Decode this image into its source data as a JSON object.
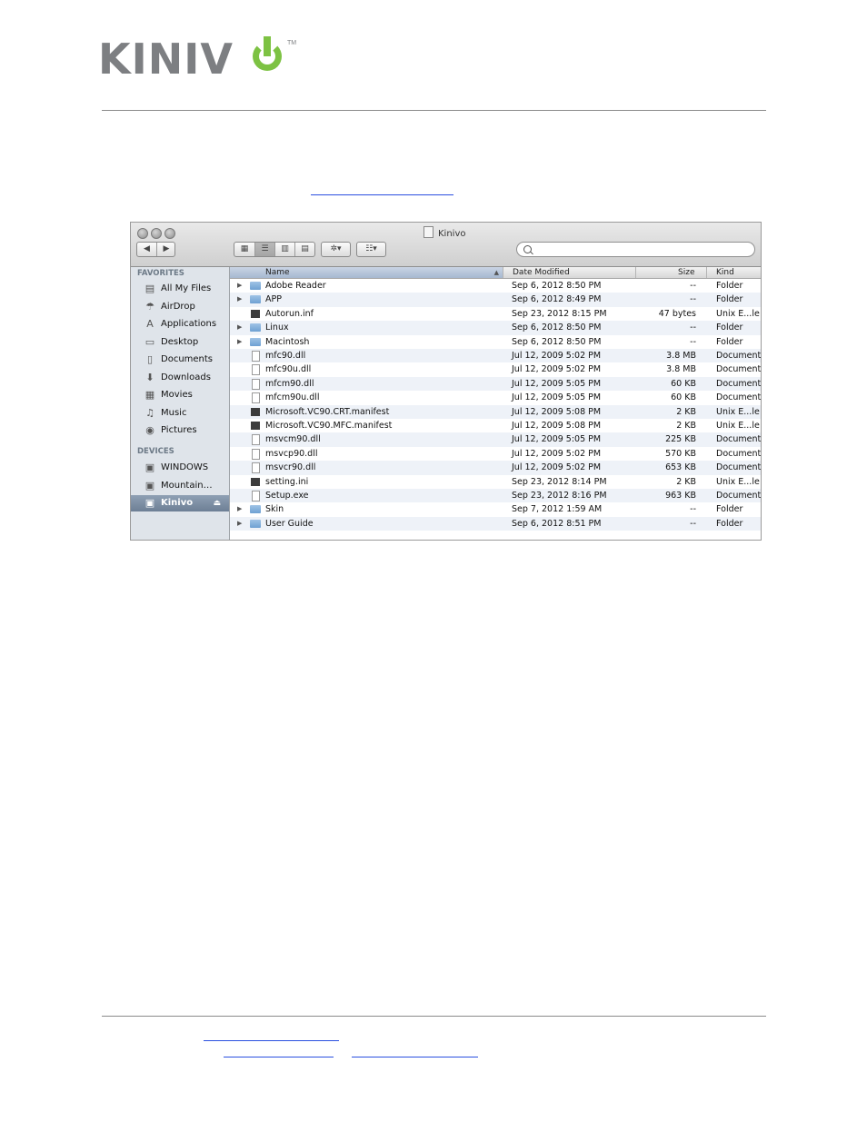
{
  "logo": {
    "text": "KINIV",
    "tm": "TM"
  },
  "window": {
    "title": "Kinivo"
  },
  "toolbar": {
    "back": "◀",
    "forward": "▶",
    "action_label": "✲▾",
    "arrange_label": "☷▾"
  },
  "sidebar": {
    "favorites_header": "FAVORITES",
    "devices_header": "DEVICES",
    "favorites": [
      {
        "label": "All My Files",
        "icon": "all-files-icon"
      },
      {
        "label": "AirDrop",
        "icon": "airdrop-icon"
      },
      {
        "label": "Applications",
        "icon": "applications-icon"
      },
      {
        "label": "Desktop",
        "icon": "desktop-icon"
      },
      {
        "label": "Documents",
        "icon": "documents-icon"
      },
      {
        "label": "Downloads",
        "icon": "downloads-icon"
      },
      {
        "label": "Movies",
        "icon": "movies-icon"
      },
      {
        "label": "Music",
        "icon": "music-icon"
      },
      {
        "label": "Pictures",
        "icon": "pictures-icon"
      }
    ],
    "devices": [
      {
        "label": "WINDOWS",
        "icon": "drive-icon"
      },
      {
        "label": "Mountain…",
        "icon": "drive-icon"
      },
      {
        "label": "Kinivo",
        "icon": "drive-icon",
        "selected": true
      }
    ]
  },
  "columns": {
    "name": "Name",
    "date": "Date Modified",
    "size": "Size",
    "kind": "Kind"
  },
  "files": [
    {
      "name": "Adobe Reader",
      "date": "Sep 6, 2012 8:50 PM",
      "size": "--",
      "kind": "Folder",
      "type": "folder"
    },
    {
      "name": "APP",
      "date": "Sep 6, 2012 8:49 PM",
      "size": "--",
      "kind": "Folder",
      "type": "folder"
    },
    {
      "name": "Autorun.inf",
      "date": "Sep 23, 2012 8:15 PM",
      "size": "47 bytes",
      "kind": "Unix E...le",
      "type": "unix"
    },
    {
      "name": "Linux",
      "date": "Sep 6, 2012 8:50 PM",
      "size": "--",
      "kind": "Folder",
      "type": "folder"
    },
    {
      "name": "Macintosh",
      "date": "Sep 6, 2012 8:50 PM",
      "size": "--",
      "kind": "Folder",
      "type": "folder"
    },
    {
      "name": "mfc90.dll",
      "date": "Jul 12, 2009 5:02 PM",
      "size": "3.8 MB",
      "kind": "Document",
      "type": "doc"
    },
    {
      "name": "mfc90u.dll",
      "date": "Jul 12, 2009 5:02 PM",
      "size": "3.8 MB",
      "kind": "Document",
      "type": "doc"
    },
    {
      "name": "mfcm90.dll",
      "date": "Jul 12, 2009 5:05 PM",
      "size": "60 KB",
      "kind": "Document",
      "type": "doc"
    },
    {
      "name": "mfcm90u.dll",
      "date": "Jul 12, 2009 5:05 PM",
      "size": "60 KB",
      "kind": "Document",
      "type": "doc"
    },
    {
      "name": "Microsoft.VC90.CRT.manifest",
      "date": "Jul 12, 2009 5:08 PM",
      "size": "2 KB",
      "kind": "Unix E...le",
      "type": "unix"
    },
    {
      "name": "Microsoft.VC90.MFC.manifest",
      "date": "Jul 12, 2009 5:08 PM",
      "size": "2 KB",
      "kind": "Unix E...le",
      "type": "unix"
    },
    {
      "name": "msvcm90.dll",
      "date": "Jul 12, 2009 5:05 PM",
      "size": "225 KB",
      "kind": "Document",
      "type": "doc"
    },
    {
      "name": "msvcp90.dll",
      "date": "Jul 12, 2009 5:02 PM",
      "size": "570 KB",
      "kind": "Document",
      "type": "doc"
    },
    {
      "name": "msvcr90.dll",
      "date": "Jul 12, 2009 5:02 PM",
      "size": "653 KB",
      "kind": "Document",
      "type": "doc"
    },
    {
      "name": "setting.ini",
      "date": "Sep 23, 2012 8:14 PM",
      "size": "2 KB",
      "kind": "Unix E...le",
      "type": "unix"
    },
    {
      "name": "Setup.exe",
      "date": "Sep 23, 2012 8:16 PM",
      "size": "963 KB",
      "kind": "Document",
      "type": "doc"
    },
    {
      "name": "Skin",
      "date": "Sep 7, 2012 1:59 AM",
      "size": "--",
      "kind": "Folder",
      "type": "folder"
    },
    {
      "name": "User Guide",
      "date": "Sep 6, 2012 8:51 PM",
      "size": "--",
      "kind": "Folder",
      "type": "folder"
    }
  ]
}
